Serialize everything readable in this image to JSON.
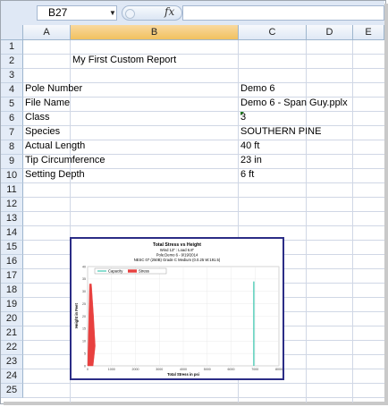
{
  "formula_bar": {
    "name_box": "B27",
    "fx_label": "fx",
    "formula": ""
  },
  "columns": [
    "A",
    "B",
    "C",
    "D",
    "E"
  ],
  "rows": [
    "1",
    "2",
    "3",
    "4",
    "5",
    "6",
    "7",
    "8",
    "9",
    "10",
    "11",
    "12",
    "13",
    "14",
    "15",
    "16",
    "17",
    "18",
    "19",
    "20",
    "21",
    "22",
    "23",
    "24",
    "25"
  ],
  "report": {
    "title": "My First Custom Report",
    "fields": [
      {
        "label": "Pole Number",
        "value": "Demo 6"
      },
      {
        "label": "File Name",
        "value": "Demo 6 - Span Guy.pplx"
      },
      {
        "label": "Class",
        "value": "3"
      },
      {
        "label": "Species",
        "value": "SOUTHERN PINE"
      },
      {
        "label": "Actual Length",
        "value": "40 ft"
      },
      {
        "label": "Tip Circumference",
        "value": "23 in"
      },
      {
        "label": "Setting Depth",
        "value": "6 ft"
      }
    ]
  },
  "colors": {
    "capacity": "#40c8b0",
    "stress": "#e8403f",
    "chart_border": "#2b2d86"
  },
  "chart_data": {
    "type": "area",
    "title": "Total Stress vs Height",
    "subtitle_lines": [
      "Wind 13\" : Load 6.8\"",
      "Pole:Demo 6 - 9/19/2014",
      "NESC 07 (250B) Grade C Medium (0.0.25 W:191.5)"
    ],
    "xlabel": "Total Stress in psi",
    "ylabel": "Height in Feet",
    "xlim": [
      0,
      8000
    ],
    "ylim": [
      0,
      40
    ],
    "x_ticks": [
      "0",
      "1000",
      "2000",
      "3000",
      "4000",
      "5000",
      "6000",
      "7000",
      "8000"
    ],
    "y_ticks": [
      "0",
      "5",
      "10",
      "15",
      "20",
      "25",
      "30",
      "35",
      "40"
    ],
    "legend": {
      "placement": "top-left",
      "entries": [
        "Capacity",
        "Stress"
      ]
    },
    "series": [
      {
        "name": "Capacity",
        "x": [
          6950,
          6950
        ],
        "y": [
          0,
          34
        ]
      },
      {
        "name": "Stress",
        "x": [
          0,
          80,
          160,
          250,
          320,
          230,
          0
        ],
        "y": [
          0,
          33,
          33,
          20,
          8,
          0,
          0
        ]
      }
    ]
  }
}
